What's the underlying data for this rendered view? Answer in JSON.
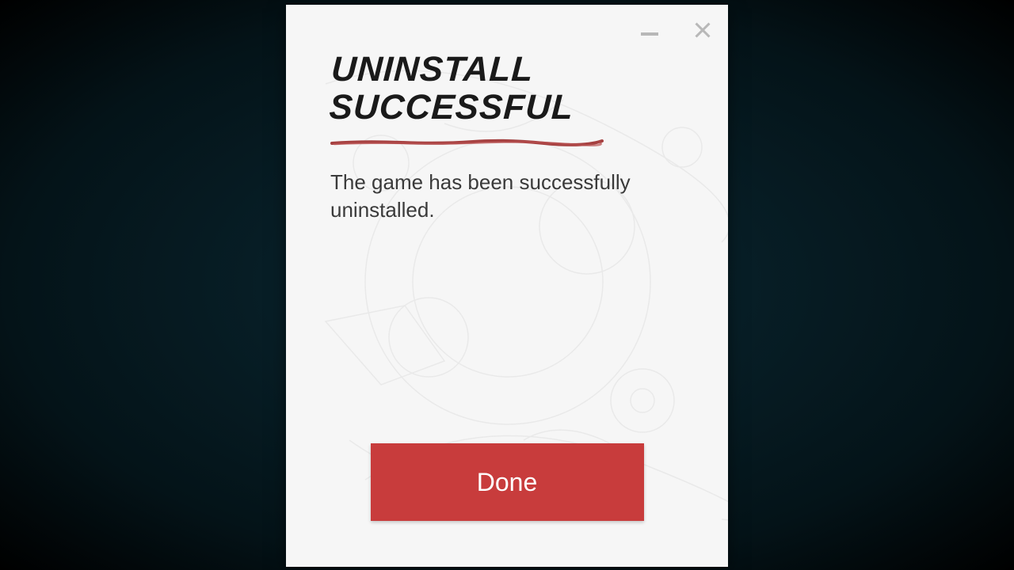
{
  "dialog": {
    "title_line1": "UNINSTALL",
    "title_line2": "SUCCESSFUL",
    "message": "The game has been successfully uninstalled.",
    "done_label": "Done"
  },
  "colors": {
    "accent_red": "#c83c3c",
    "underline_red": "#a54040"
  }
}
